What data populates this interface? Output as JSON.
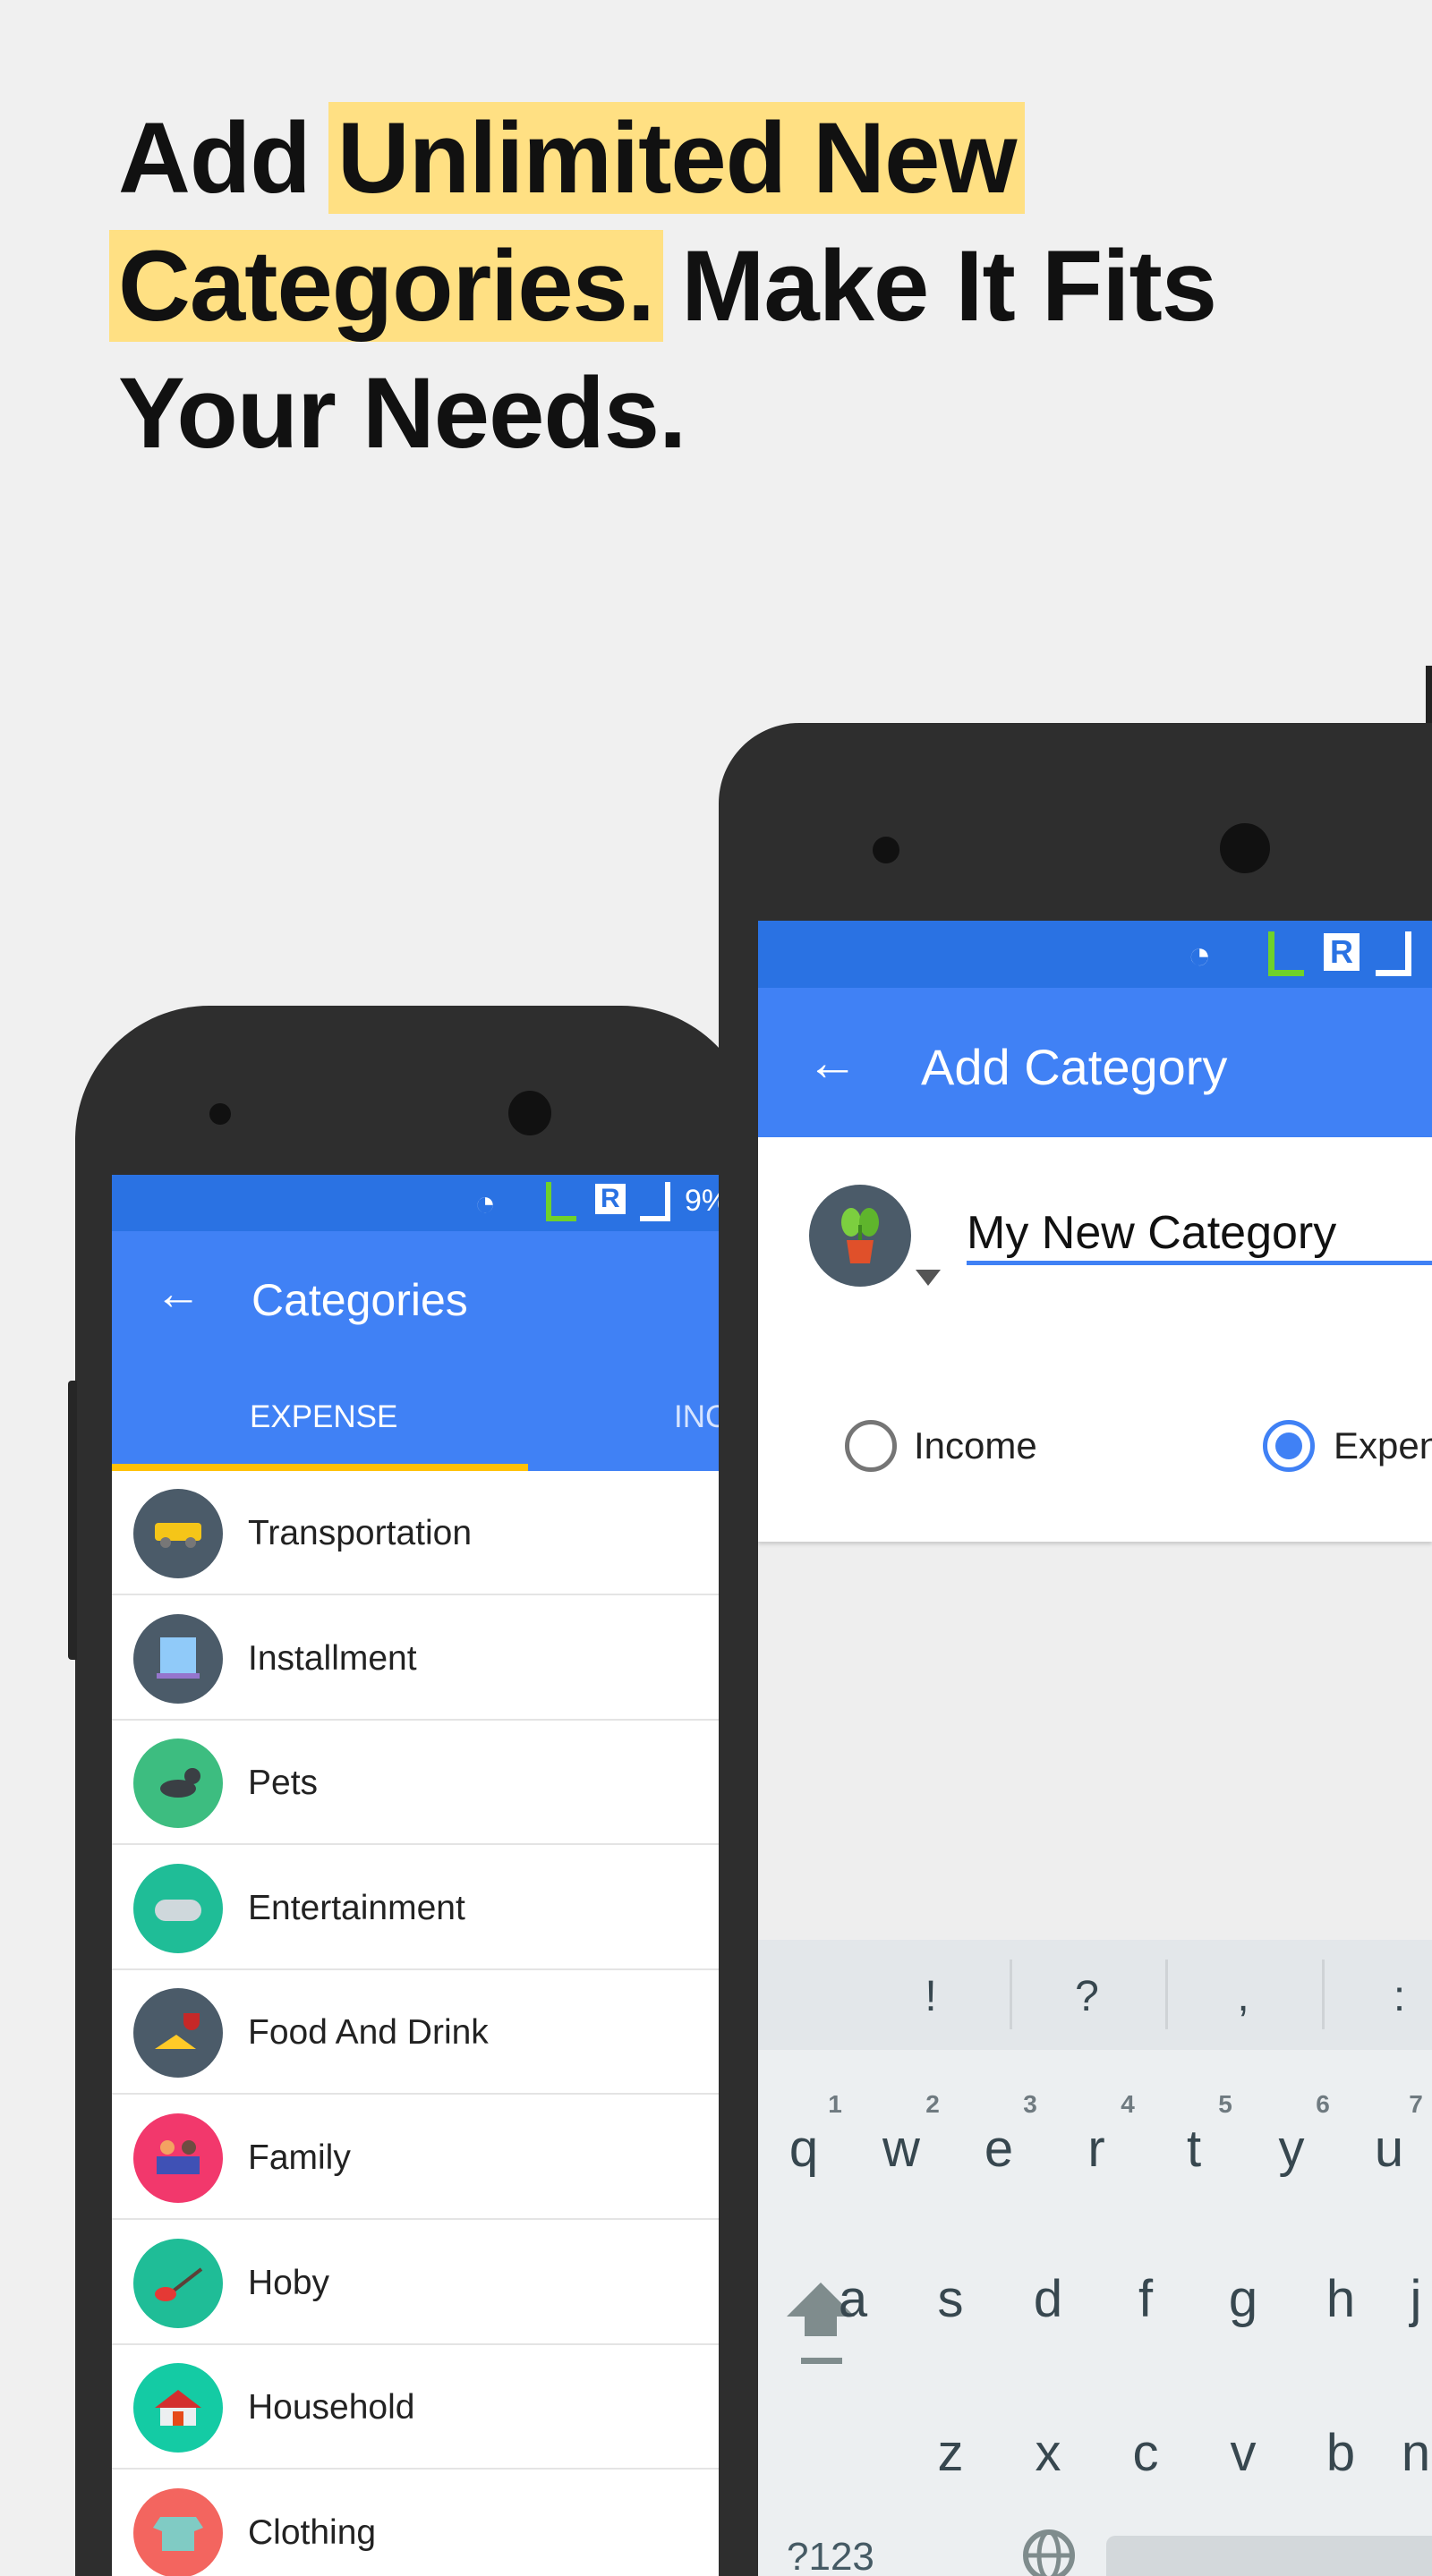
{
  "headline": {
    "line1_plain": "Add ",
    "line1_highlight": "Unlimited New",
    "line2_highlight": "Categories.",
    "line2_plain": " Make It Fits",
    "line3": "Your Needs."
  },
  "colors": {
    "highlight": "#ffe083",
    "primary": "#4081f5",
    "status": "#2a72e3",
    "tab_indicator": "#ffc107"
  },
  "left_screen": {
    "status_battery": "9%",
    "title": "Categories",
    "back_icon": "arrow-left-icon",
    "tabs": [
      {
        "label": "EXPENSE",
        "selected": true
      },
      {
        "label": "INCOME",
        "selected": false
      }
    ],
    "categories": [
      {
        "label": "Transportation",
        "icon": "car-icon",
        "color": "#4b5b69"
      },
      {
        "label": "Installment",
        "icon": "receipt-icon",
        "color": "#4b5b69"
      },
      {
        "label": "Pets",
        "icon": "cat-icon",
        "color": "#3dbd80"
      },
      {
        "label": "Entertainment",
        "icon": "gamepad-icon",
        "color": "#1fbd97"
      },
      {
        "label": "Food And Drink",
        "icon": "wine-cheese-icon",
        "color": "#4b5b69"
      },
      {
        "label": "Family",
        "icon": "family-icon",
        "color": "#f2386c"
      },
      {
        "label": "Hoby",
        "icon": "guitar-icon",
        "color": "#1fbd97"
      },
      {
        "label": "Household",
        "icon": "house-icon",
        "color": "#14cba4"
      },
      {
        "label": "Clothing",
        "icon": "shirt-icon",
        "color": "#f3655f"
      }
    ]
  },
  "right_screen": {
    "title": "Add Category",
    "back_icon": "arrow-left-icon",
    "category_icon": "plant-icon",
    "name_value": "My New Category",
    "type_options": [
      {
        "label": "Income",
        "selected": false
      },
      {
        "label": "Expense",
        "selected": true
      }
    ],
    "keyboard": {
      "suggestions": [
        "!",
        "?",
        ",",
        ":"
      ],
      "row1": [
        "q",
        "w",
        "e",
        "r",
        "t",
        "y",
        "u"
      ],
      "row1_hints": [
        "1",
        "2",
        "3",
        "4",
        "5",
        "6",
        "7"
      ],
      "row2": [
        "a",
        "s",
        "d",
        "f",
        "g",
        "h",
        "j"
      ],
      "row3": [
        "z",
        "x",
        "c",
        "v",
        "b",
        "n"
      ],
      "symbols_label": "?123",
      "shift_icon": "shift-icon",
      "globe_icon": "globe-icon"
    }
  }
}
